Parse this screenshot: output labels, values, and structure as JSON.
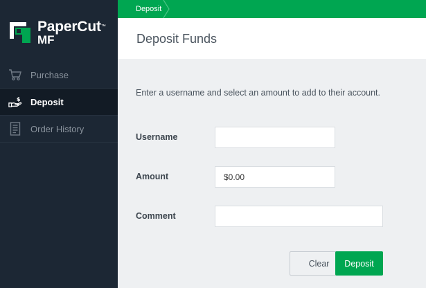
{
  "brand": {
    "name": "PaperCut",
    "sub": "MF",
    "tm": "™"
  },
  "sidebar": {
    "items": [
      {
        "label": "Purchase",
        "icon": "cart-icon",
        "active": false
      },
      {
        "label": "Deposit",
        "icon": "deposit-hand-icon",
        "active": true
      },
      {
        "label": "Order History",
        "icon": "receipt-icon",
        "active": false
      }
    ]
  },
  "breadcrumb": {
    "current": "Deposit"
  },
  "page": {
    "title": "Deposit Funds"
  },
  "form": {
    "intro": "Enter a username and select an amount to add to their account.",
    "username": {
      "label": "Username",
      "value": "",
      "placeholder": ""
    },
    "amount": {
      "label": "Amount",
      "value": "$0.00"
    },
    "comment": {
      "label": "Comment",
      "value": "",
      "placeholder": ""
    }
  },
  "actions": {
    "clear": "Clear",
    "deposit": "Deposit"
  },
  "colors": {
    "accent": "#00a651",
    "sidebar": "#1c2734",
    "sidebar_active": "#121b25",
    "background": "#eef0f2"
  }
}
